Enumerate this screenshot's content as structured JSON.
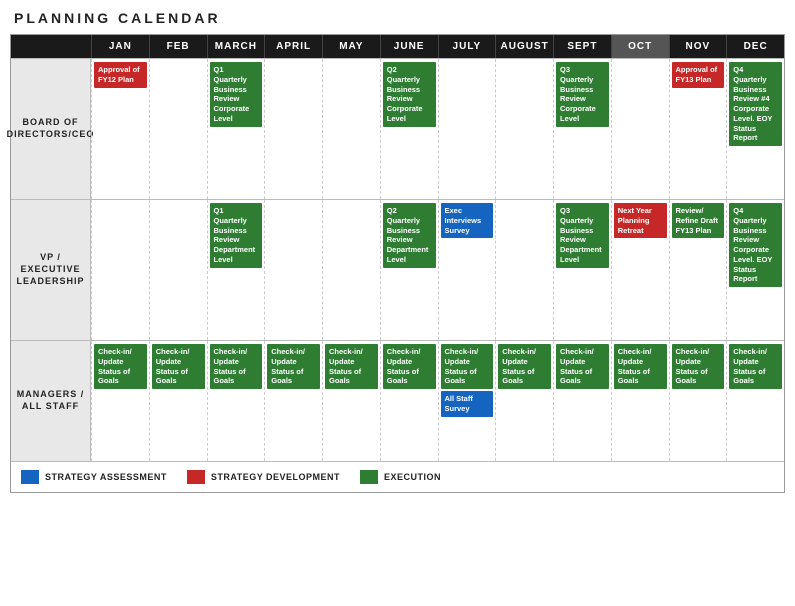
{
  "title": "PLANNING CALENDAR",
  "months": [
    "JAN",
    "FEB",
    "MARCH",
    "APRIL",
    "MAY",
    "JUNE",
    "JULY",
    "AUGUST",
    "SEPT",
    "OCT",
    "NOV",
    "DEC"
  ],
  "sections": [
    {
      "label": "BOARD OF\nDIRECTORS/CEO",
      "events": {
        "JAN": [
          {
            "text": "Approval of FY12 Plan",
            "color": "red"
          }
        ],
        "MARCH": [
          {
            "text": "Q1 Quarterly Business Review Corporate Level",
            "color": "green"
          }
        ],
        "JUNE": [
          {
            "text": "Q2 Quarterly Business Review Corporate Level",
            "color": "green"
          }
        ],
        "SEPT": [
          {
            "text": "Q3 Quarterly Business Review Corporate Level",
            "color": "green"
          }
        ],
        "NOV": [
          {
            "text": "Approval of FY13 Plan",
            "color": "red"
          }
        ],
        "DEC": [
          {
            "text": "Q4 Quarterly Business Review #4 Corporate Level. EOY Status Report",
            "color": "green"
          }
        ]
      }
    },
    {
      "label": "VP / EXECUTIVE\nLEADERSHIP",
      "events": {
        "MARCH": [
          {
            "text": "Q1 Quarterly Business Review Department Level",
            "color": "green"
          }
        ],
        "JUNE": [
          {
            "text": "Q2 Quarterly Business Review Department Level",
            "color": "green"
          }
        ],
        "JULY": [
          {
            "text": "Exec Interviews Survey",
            "color": "blue"
          }
        ],
        "OCT": [
          {
            "text": "Next Year Planning Retreat",
            "color": "red"
          }
        ],
        "SEPT": [
          {
            "text": "Q3 Quarterly Business Review Department Level",
            "color": "green"
          }
        ],
        "NOV": [
          {
            "text": "Review/ Refine Draft FY13 Plan",
            "color": "green"
          }
        ],
        "DEC": [
          {
            "text": "Q4 Quarterly Business Review Corporate Level. EOY Status Report",
            "color": "green"
          }
        ]
      }
    },
    {
      "label": "MANAGERS /\nALL STAFF",
      "events": {
        "JAN": [
          {
            "text": "Check-in/ Update Status of Goals",
            "color": "green"
          }
        ],
        "FEB": [
          {
            "text": "Check-in/ Update Status of Goals",
            "color": "green"
          }
        ],
        "MARCH": [
          {
            "text": "Check-in/ Update Status of Goals",
            "color": "green"
          }
        ],
        "APRIL": [
          {
            "text": "Check-in/ Update Status of Goals",
            "color": "green"
          }
        ],
        "MAY": [
          {
            "text": "Check-in/ Update Status of Goals",
            "color": "green"
          }
        ],
        "JUNE": [
          {
            "text": "Check-in/ Update Status of Goals",
            "color": "green"
          }
        ],
        "JULY": [
          {
            "text": "Check-in/ Update Status of Goals",
            "color": "green"
          },
          {
            "text": "All Staff Survey",
            "color": "blue"
          }
        ],
        "AUGUST": [
          {
            "text": "Check-in/ Update Status of Goals",
            "color": "green"
          }
        ],
        "SEPT": [
          {
            "text": "Check-in/ Update Status of Goals",
            "color": "green"
          }
        ],
        "OCT": [
          {
            "text": "Check-in/ Update Status of Goals",
            "color": "green"
          }
        ],
        "NOV": [
          {
            "text": "Check-in/ Update Status of Goals",
            "color": "green"
          }
        ],
        "DEC": [
          {
            "text": "Check-in/ Update Status of Goals",
            "color": "green"
          }
        ]
      }
    }
  ],
  "legend": [
    {
      "label": "STRATEGY ASSESSMENT",
      "color": "blue"
    },
    {
      "label": "STRATEGY DEVELOPMENT",
      "color": "red"
    },
    {
      "label": "EXECUTION",
      "color": "green"
    }
  ]
}
